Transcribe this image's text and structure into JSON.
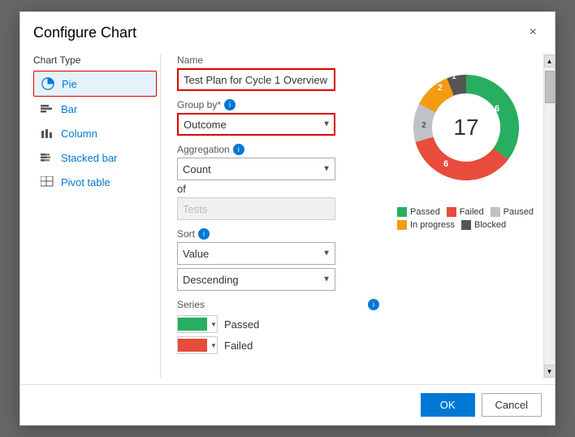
{
  "dialog": {
    "title": "Configure Chart",
    "close_label": "×"
  },
  "chart_type": {
    "label": "Chart Type",
    "items": [
      {
        "id": "pie",
        "label": "Pie",
        "active": true
      },
      {
        "id": "bar",
        "label": "Bar",
        "active": false
      },
      {
        "id": "column",
        "label": "Column",
        "active": false
      },
      {
        "id": "stacked-bar",
        "label": "Stacked bar",
        "active": false
      },
      {
        "id": "pivot-table",
        "label": "Pivot table",
        "active": false
      }
    ]
  },
  "config": {
    "name_label": "Name",
    "name_value": "Test Plan for Cycle 1 Overview",
    "group_by_label": "Group by*",
    "group_by_value": "Outcome",
    "aggregation_label": "Aggregation",
    "aggregation_value": "Count",
    "of_text": "of",
    "of_placeholder": "Tests",
    "sort_label": "Sort",
    "sort_value": "Value",
    "sort_direction": "Descending",
    "series_label": "Series",
    "series_items": [
      {
        "color": "#27ae60",
        "name": "Passed"
      },
      {
        "color": "#e74c3c",
        "name": "Failed"
      }
    ]
  },
  "preview": {
    "center_value": "17",
    "segments": [
      {
        "label": "Passed",
        "color": "#27ae60",
        "value": 6,
        "percent": 35
      },
      {
        "label": "Failed",
        "color": "#e74c3c",
        "value": 6,
        "percent": 35
      },
      {
        "label": "Paused",
        "color": "#bdc3c7",
        "value": 2,
        "percent": 12
      },
      {
        "label": "In progress",
        "color": "#f39c12",
        "value": 2,
        "percent": 12
      },
      {
        "label": "Blocked",
        "color": "#555555",
        "value": 1,
        "percent": 6
      }
    ],
    "legend": [
      {
        "label": "Passed",
        "color": "#27ae60"
      },
      {
        "label": "Failed",
        "color": "#e74c3c"
      },
      {
        "label": "Paused",
        "color": "#bdc3c7"
      },
      {
        "label": "In progress",
        "color": "#f39c12"
      },
      {
        "label": "Blocked",
        "color": "#555555"
      }
    ]
  },
  "footer": {
    "ok_label": "OK",
    "cancel_label": "Cancel"
  }
}
